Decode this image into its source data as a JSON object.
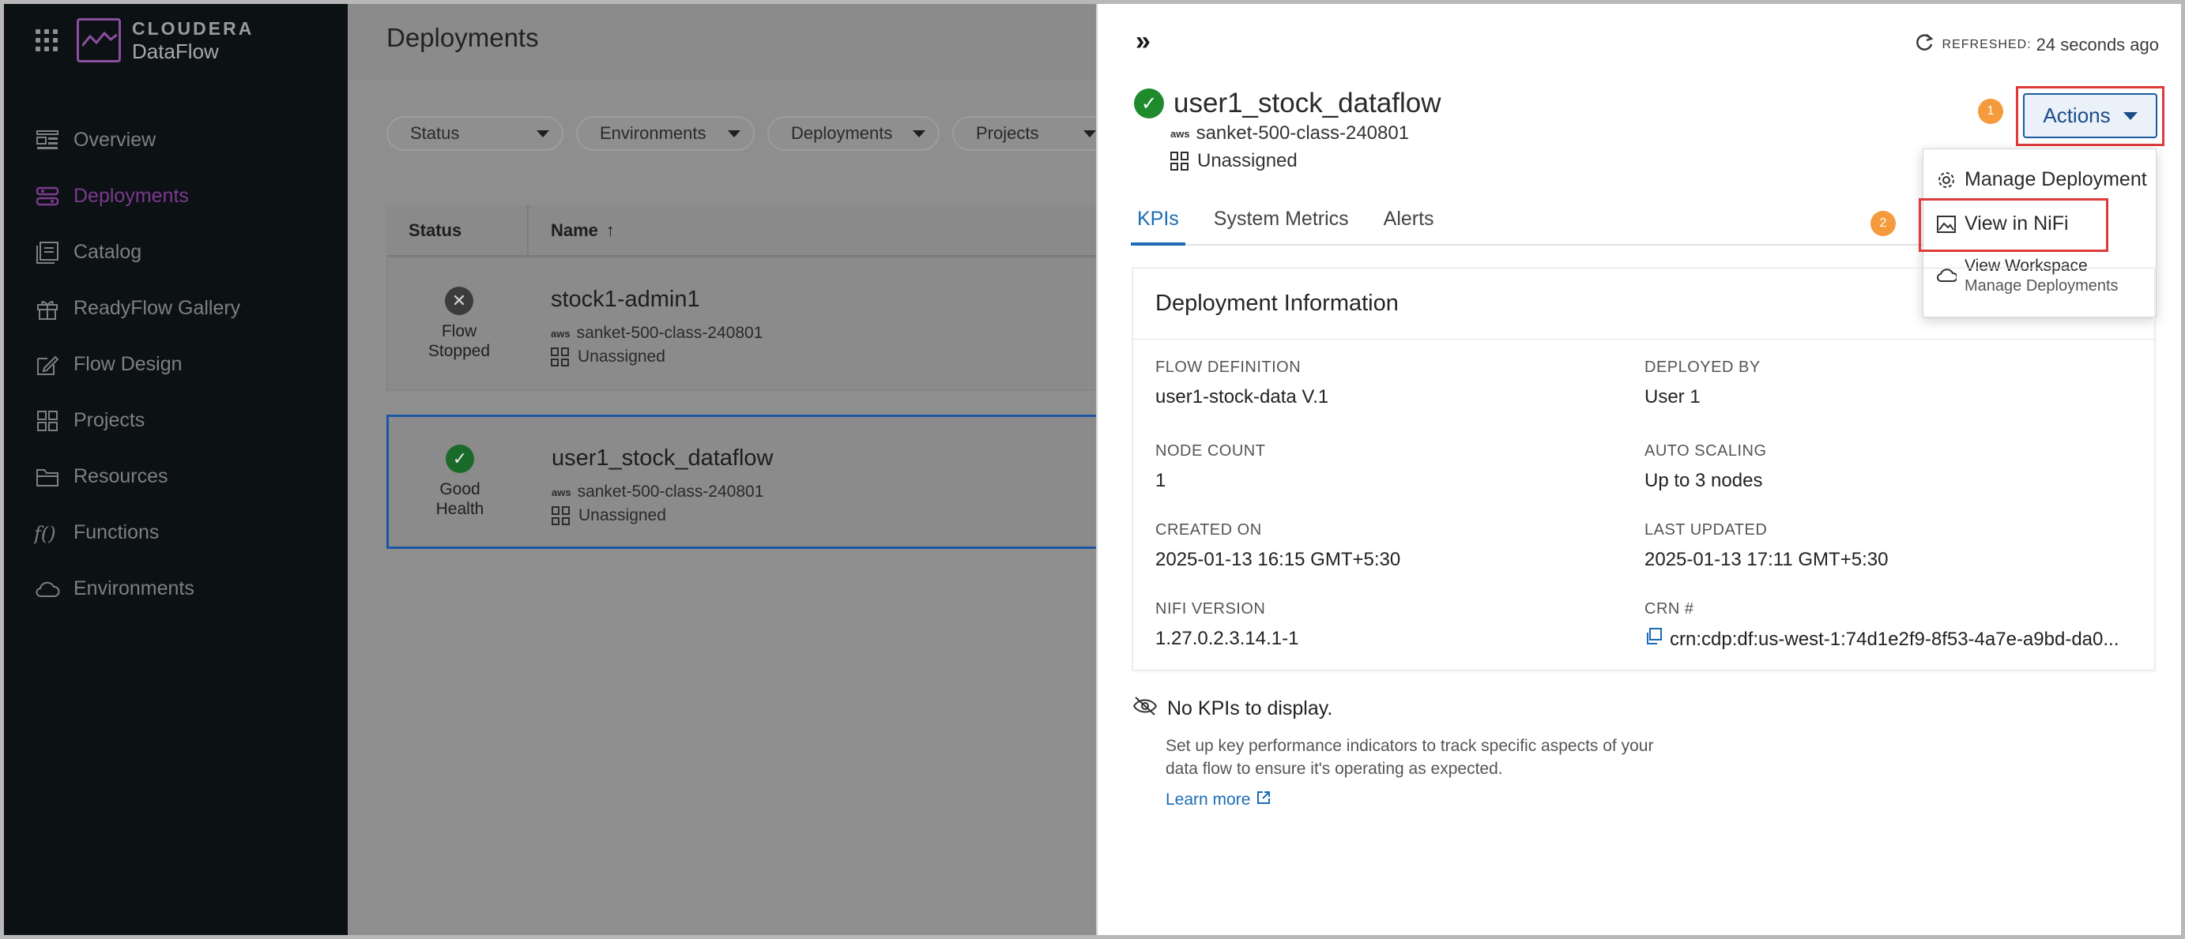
{
  "brand": {
    "name": "CLOUDERA",
    "product": "DataFlow"
  },
  "sidebar": {
    "items": [
      {
        "label": "Overview",
        "icon": "overview-icon",
        "active": false
      },
      {
        "label": "Deployments",
        "icon": "deployments-icon",
        "active": true
      },
      {
        "label": "Catalog",
        "icon": "catalog-icon",
        "active": false
      },
      {
        "label": "ReadyFlow Gallery",
        "icon": "gift-icon",
        "active": false
      },
      {
        "label": "Flow Design",
        "icon": "edit-icon",
        "active": false
      },
      {
        "label": "Projects",
        "icon": "projects-icon",
        "active": false
      },
      {
        "label": "Resources",
        "icon": "folder-icon",
        "active": false
      },
      {
        "label": "Functions",
        "icon": "function-icon",
        "active": false
      },
      {
        "label": "Environments",
        "icon": "cloud-icon",
        "active": false
      }
    ]
  },
  "main": {
    "title": "Deployments",
    "filters": [
      "Status",
      "Environments",
      "Deployments",
      "Projects"
    ],
    "columns": {
      "status": "Status",
      "name": "Name"
    },
    "rows": [
      {
        "status": "Flow Stopped",
        "name": "stock1-admin1",
        "environment": "sanket-500-class-240801",
        "project": "Unassigned"
      },
      {
        "status": "Good Health",
        "name": "user1_stock_dataflow",
        "environment": "sanket-500-class-240801",
        "project": "Unassigned"
      }
    ]
  },
  "drawer": {
    "refreshed_label": "REFRESHED:",
    "refreshed_value": "24 seconds ago",
    "title": "user1_stock_dataflow",
    "environment": "sanket-500-class-240801",
    "project": "Unassigned",
    "tabs": [
      "KPIs",
      "System Metrics",
      "Alerts"
    ],
    "actions_label": "Actions",
    "badges": [
      "1",
      "2"
    ],
    "menu": {
      "manage": "Manage Deployment",
      "view_nifi": "View in NiFi",
      "view_workspace": "View Workspace",
      "view_workspace_sub": "Manage Deployments"
    },
    "info": {
      "heading": "Deployment Information",
      "flow_definition_label": "FLOW DEFINITION",
      "flow_definition": "user1-stock-data V.1",
      "deployed_by_label": "DEPLOYED BY",
      "deployed_by": "User 1",
      "node_count_label": "NODE COUNT",
      "node_count": "1",
      "auto_scaling_label": "AUTO SCALING",
      "auto_scaling": "Up to 3 nodes",
      "created_on_label": "CREATED ON",
      "created_on": "2025-01-13 16:15 GMT+5:30",
      "last_updated_label": "LAST UPDATED",
      "last_updated": "2025-01-13 17:11 GMT+5:30",
      "nifi_version_label": "NIFI VERSION",
      "nifi_version": "1.27.0.2.3.14.1-1",
      "crn_label": "CRN #",
      "crn": "crn:cdp:df:us-west-1:74d1e2f9-8f53-4a7e-a9bd-da0..."
    },
    "kpi": {
      "empty": "No KPIs to display.",
      "desc": "Set up key performance indicators to track specific aspects of your data flow to ensure it's operating as expected.",
      "learn_more": "Learn more"
    }
  },
  "colors": {
    "accent": "#1b6bb5",
    "highlight": "#e03b3b",
    "badge": "#f59a3d",
    "brand": "#8b4fa0"
  }
}
